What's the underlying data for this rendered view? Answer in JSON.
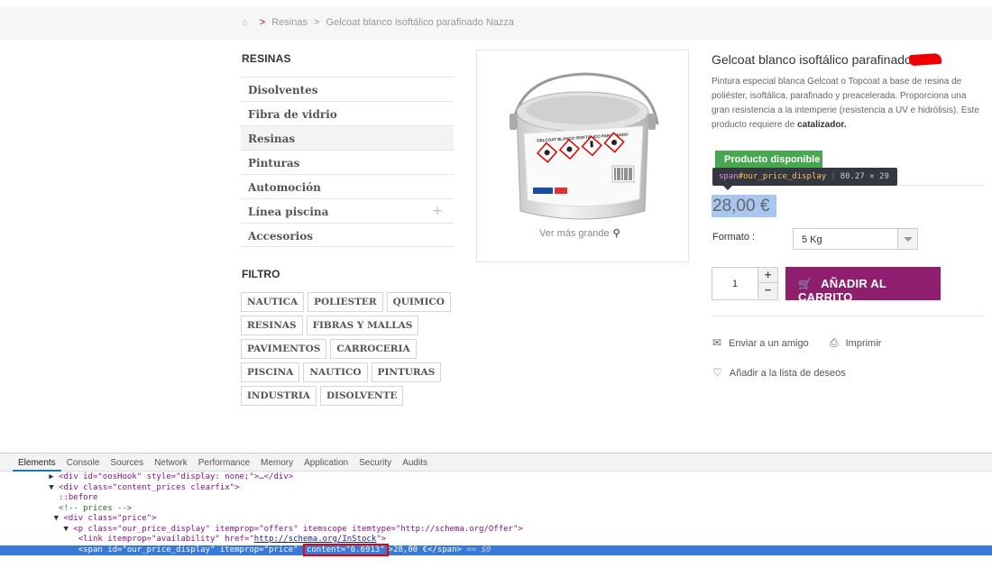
{
  "breadcrumb": {
    "separator": ">",
    "items": [
      "Resinas",
      "Gelcoat blanco isoftálico parafinado Nazza"
    ]
  },
  "sidebar": {
    "title": "RESINAS",
    "categories": [
      {
        "label": "Disolventes"
      },
      {
        "label": "Fibra de vidrio"
      },
      {
        "label": "Resinas"
      },
      {
        "label": "Pinturas"
      },
      {
        "label": "Automoción"
      },
      {
        "label": "Línea piscina",
        "expand": "+"
      },
      {
        "label": "Accesorios"
      }
    ],
    "filter_title": "FILTRO",
    "tags": [
      [
        "NAUTICA",
        "POLIESTER",
        "QUIMICO"
      ],
      [
        "RESINAS",
        "FIBRAS Y MALLAS"
      ],
      [
        "PAVIMENTOS",
        "CARROCERIA"
      ],
      [
        "PISCINA",
        "NAUTICO",
        "PINTURAS"
      ],
      [
        "INDUSTRIA",
        "DISOLVENTE"
      ]
    ]
  },
  "product": {
    "image_label": "GELCOAT BLANCO ISOFTÁLICO PARAFINADO",
    "zoom_label": "Ver más grande",
    "title": "Gelcoat blanco isoftálico parafinado",
    "description_main": "Pintura especial blanca Gelcoat o Topcoat a base de resina de poliéster, isoftálica, parafinado y preacelerada. Proporciona una gran resistencia a la intemperie (resistencia a UV e hidrólisis). Este producto requiere de",
    "description_bold": "catalizador.",
    "availability": "Producto disponible",
    "price": "28,00 €",
    "formato_label": "Formato :",
    "formato_value": "5 Kg",
    "quantity": "1",
    "add_to_cart": "AÑADIR AL CARRITO",
    "send_friend": "Enviar a un amigo",
    "print": "Imprimir",
    "wishlist": "Añadir a la lista de deseos"
  },
  "inspector_tooltip": {
    "tag": "span",
    "id": "#our_price_display",
    "size": "80.27 × 29"
  },
  "devtools": {
    "tabs": [
      "Elements",
      "Console",
      "Sources",
      "Network",
      "Performance",
      "Memory",
      "Application",
      "Security",
      "Audits"
    ],
    "active_tab": "Elements",
    "lines": {
      "l1": "<div id=\"oosHook\" style=\"display: none;\">…</div>",
      "l2": "<div class=\"content_prices clearfix\">",
      "l3": "::before",
      "l4": "<!-- prices -->",
      "l5": "<div class=\"price\">",
      "l6": "<p class=\"our_price_display\" itemprop=\"offers\" itemscope itemtype=\"http://schema.org/Offer\">",
      "l7_pre": "<link itemprop=\"availability\" href=\"",
      "l7_link": "http://schema.org/InStock",
      "l7_post": "\">",
      "l8_pre": "<span id=\"our_price_display\" itemprop=\"price\" ",
      "l8_box": "content=\"6.6913\"",
      "l8_post": ">28,00 €</span>",
      "l8_eq": " == $0"
    }
  },
  "colors": {
    "cart_button": "#8e1f6e",
    "availability": "#46a74e",
    "price_highlight": "#a8c6ef",
    "devtools_selection": "#3879d9"
  }
}
